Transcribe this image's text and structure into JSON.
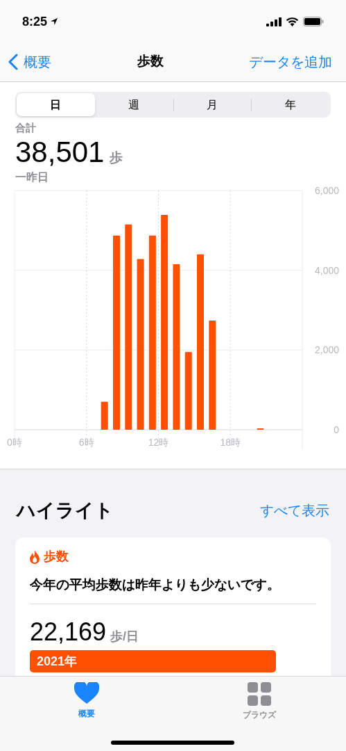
{
  "status_bar": {
    "time": "8:25"
  },
  "nav": {
    "back": "概要",
    "title": "歩数",
    "action": "データを追加"
  },
  "segments": [
    {
      "label": "日",
      "selected": true
    },
    {
      "label": "週",
      "selected": false
    },
    {
      "label": "月",
      "selected": false
    },
    {
      "label": "年",
      "selected": false
    }
  ],
  "summary": {
    "label": "合計",
    "value": "38,501",
    "unit": "歩",
    "date": "一昨日"
  },
  "chart": {
    "chart_data": {
      "type": "bar",
      "x": [
        7.5,
        8.5,
        9.5,
        10.5,
        11.5,
        12.5,
        13.5,
        14.5,
        15.5,
        16.5,
        17.5,
        18.5,
        19.5,
        20.5
      ],
      "grid": true,
      "xlim": [
        0,
        24
      ],
      "series": [
        {
          "color": "#ff4f00",
          "values": [
            700,
            4870,
            5150,
            4280,
            4870,
            5390,
            4150,
            1950,
            4400,
            2740,
            null,
            null,
            null,
            30
          ]
        }
      ],
      "ylim": [
        0,
        6000
      ],
      "xticks": [
        {
          "value": 0,
          "label": "0時"
        },
        {
          "value": 6,
          "label": "6時"
        },
        {
          "value": 12,
          "label": "12時"
        },
        {
          "value": 18,
          "label": "18時"
        }
      ],
      "yticks": [
        {
          "value": 0,
          "label": "0"
        },
        {
          "value": 2000,
          "label": "2,000"
        },
        {
          "value": 4000,
          "label": "4,000"
        },
        {
          "value": 6000,
          "label": "6,000"
        }
      ]
    }
  },
  "highlights": {
    "title": "ハイライト",
    "link": "すべて表示",
    "card": {
      "category": "歩数",
      "message": "今年の平均歩数は昨年よりも少ないです。",
      "value": "22,169",
      "unit": "歩/日",
      "bar_label": "2021年"
    }
  },
  "tab_bar": [
    {
      "label": "概要",
      "kind": "heart",
      "selected": true
    },
    {
      "label": "ブラウズ",
      "kind": "grid",
      "selected": false
    }
  ]
}
